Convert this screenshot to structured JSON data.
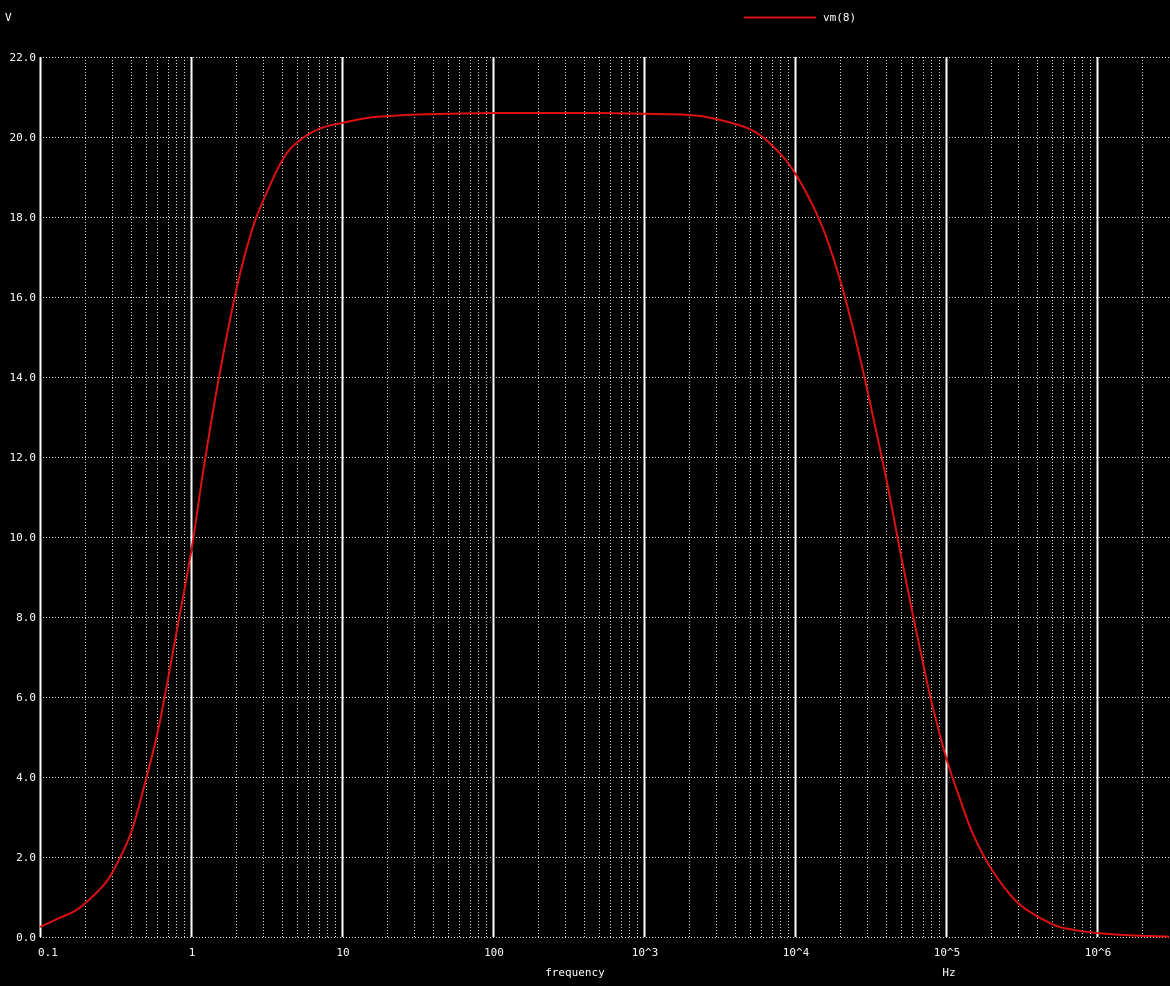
{
  "colors": {
    "background": "#000000",
    "grid": "#ffffff",
    "trace": "#dd1111",
    "text": "#ffffff"
  },
  "chart_data": {
    "type": "line",
    "xscale": "log",
    "xlim": [
      0.1,
      3000000
    ],
    "ylim": [
      0,
      22
    ],
    "grid": true,
    "legend_position": "top-right",
    "ylabel": "V",
    "xlabel": "frequency",
    "xunit": "Hz",
    "xticks": [
      {
        "value": 0.1,
        "label": "0.1"
      },
      {
        "value": 1,
        "label": "1"
      },
      {
        "value": 10,
        "label": "10"
      },
      {
        "value": 100,
        "label": "100"
      },
      {
        "value": 1000,
        "label": "10^3"
      },
      {
        "value": 10000,
        "label": "10^4"
      },
      {
        "value": 100000,
        "label": "10^5"
      },
      {
        "value": 1000000,
        "label": "10^6"
      }
    ],
    "yticks": [
      {
        "value": 0,
        "label": "0.0"
      },
      {
        "value": 2,
        "label": "2.0"
      },
      {
        "value": 4,
        "label": "4.0"
      },
      {
        "value": 6,
        "label": "6.0"
      },
      {
        "value": 8,
        "label": "8.0"
      },
      {
        "value": 10,
        "label": "10.0"
      },
      {
        "value": 12,
        "label": "12.0"
      },
      {
        "value": 14,
        "label": "14.0"
      },
      {
        "value": 16,
        "label": "16.0"
      },
      {
        "value": 18,
        "label": "18.0"
      },
      {
        "value": 20,
        "label": "20.0"
      },
      {
        "value": 22,
        "label": "22.0"
      }
    ],
    "series": [
      {
        "name": "vm(8)",
        "color": "#dd1111",
        "x": [
          0.1,
          0.13,
          0.17,
          0.2,
          0.25,
          0.3,
          0.4,
          0.5,
          0.6,
          0.7,
          0.8,
          1.0,
          1.2,
          1.5,
          2.0,
          2.5,
          3.0,
          4.0,
          5.0,
          7.0,
          10,
          15,
          20,
          30,
          50,
          100,
          200,
          500,
          1000,
          2000,
          3000,
          5000,
          7000,
          10000,
          15000,
          20000,
          25000,
          30000,
          40000,
          50000,
          60000,
          70000,
          80000,
          100000,
          120000,
          150000,
          200000,
          300000,
          500000,
          700000,
          1000000,
          1500000,
          2000000,
          3000000
        ],
        "y": [
          0.25,
          0.45,
          0.65,
          0.85,
          1.2,
          1.6,
          2.6,
          3.9,
          5.1,
          6.4,
          7.6,
          9.6,
          11.6,
          13.8,
          16.2,
          17.6,
          18.4,
          19.4,
          19.85,
          20.2,
          20.35,
          20.48,
          20.52,
          20.56,
          20.58,
          20.6,
          20.6,
          20.6,
          20.58,
          20.55,
          20.45,
          20.2,
          19.8,
          19.1,
          17.8,
          16.4,
          15.0,
          13.7,
          11.5,
          9.6,
          8.1,
          6.9,
          5.9,
          4.5,
          3.6,
          2.6,
          1.7,
          0.85,
          0.33,
          0.18,
          0.1,
          0.05,
          0.03,
          0.01
        ]
      }
    ]
  }
}
